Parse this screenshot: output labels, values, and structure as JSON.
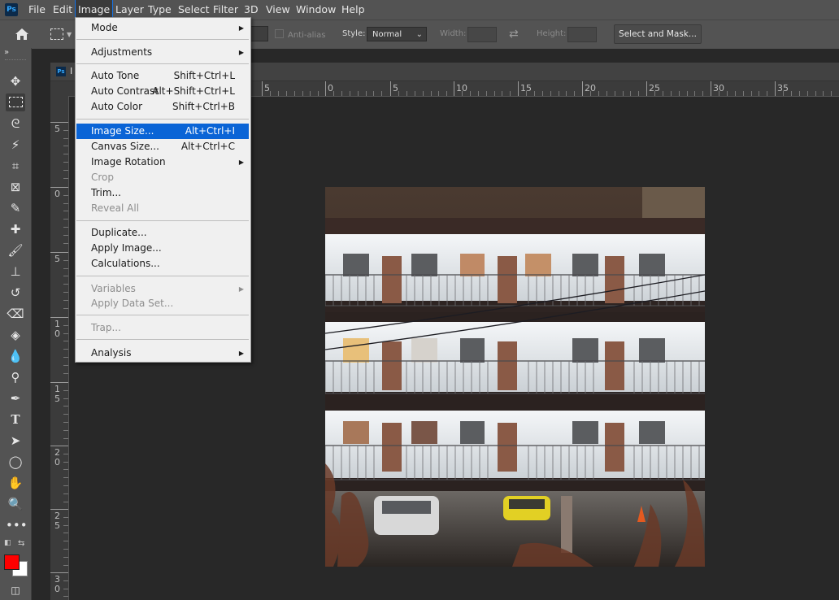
{
  "app": {
    "logo_text": "Ps",
    "menus": [
      {
        "label": "File"
      },
      {
        "label": "Edit"
      },
      {
        "label": "Image"
      },
      {
        "label": "Layer"
      },
      {
        "label": "Type"
      },
      {
        "label": "Select"
      },
      {
        "label": "Filter"
      },
      {
        "label": "3D"
      },
      {
        "label": "View"
      },
      {
        "label": "Window"
      },
      {
        "label": "Help"
      }
    ]
  },
  "options_bar": {
    "anti_alias_label": "Anti-alias",
    "style_label": "Style:",
    "style_value": "Normal",
    "width_label": "Width:",
    "height_label": "Height:",
    "select_mask_label": "Select and Mask..."
  },
  "document": {
    "tab_title": "I",
    "ps_icon_text": "Ps",
    "h_ruler": [
      "5",
      "0",
      "5",
      "10",
      "15",
      "20",
      "25",
      "30",
      "35"
    ],
    "v_ruler": [
      [
        "5"
      ],
      [
        "0"
      ],
      [
        "5"
      ],
      [
        "1",
        "0"
      ],
      [
        "1",
        "5"
      ],
      [
        "2",
        "0"
      ],
      [
        "2",
        "5"
      ],
      [
        "3",
        "0"
      ]
    ]
  },
  "image_menu": {
    "items": [
      {
        "label": "Mode",
        "shortcut": "",
        "submenu": true,
        "disabled": false
      },
      {
        "label": "Adjustments",
        "shortcut": "",
        "submenu": true,
        "disabled": false
      },
      {
        "label": "Auto Tone",
        "shortcut": "Shift+Ctrl+L",
        "submenu": false,
        "disabled": false
      },
      {
        "label": "Auto Contrast",
        "shortcut": "Alt+Shift+Ctrl+L",
        "submenu": false,
        "disabled": false
      },
      {
        "label": "Auto Color",
        "shortcut": "Shift+Ctrl+B",
        "submenu": false,
        "disabled": false
      },
      {
        "label": "Image Size...",
        "shortcut": "Alt+Ctrl+I",
        "submenu": false,
        "disabled": false,
        "highlighted": true
      },
      {
        "label": "Canvas Size...",
        "shortcut": "Alt+Ctrl+C",
        "submenu": false,
        "disabled": false
      },
      {
        "label": "Image Rotation",
        "shortcut": "",
        "submenu": true,
        "disabled": false
      },
      {
        "label": "Crop",
        "shortcut": "",
        "submenu": false,
        "disabled": true
      },
      {
        "label": "Trim...",
        "shortcut": "",
        "submenu": false,
        "disabled": false
      },
      {
        "label": "Reveal All",
        "shortcut": "",
        "submenu": false,
        "disabled": true
      },
      {
        "label": "Duplicate...",
        "shortcut": "",
        "submenu": false,
        "disabled": false
      },
      {
        "label": "Apply Image...",
        "shortcut": "",
        "submenu": false,
        "disabled": false
      },
      {
        "label": "Calculations...",
        "shortcut": "",
        "submenu": false,
        "disabled": false
      },
      {
        "label": "Variables",
        "shortcut": "",
        "submenu": true,
        "disabled": true
      },
      {
        "label": "Apply Data Set...",
        "shortcut": "",
        "submenu": false,
        "disabled": true
      },
      {
        "label": "Trap...",
        "shortcut": "",
        "submenu": false,
        "disabled": true
      },
      {
        "label": "Analysis",
        "shortcut": "",
        "submenu": true,
        "disabled": false
      }
    ]
  },
  "colors": {
    "foreground": "#ff0000",
    "background": "#ffffff",
    "highlight": "#0a64d6",
    "ui_dark": "#535353"
  }
}
